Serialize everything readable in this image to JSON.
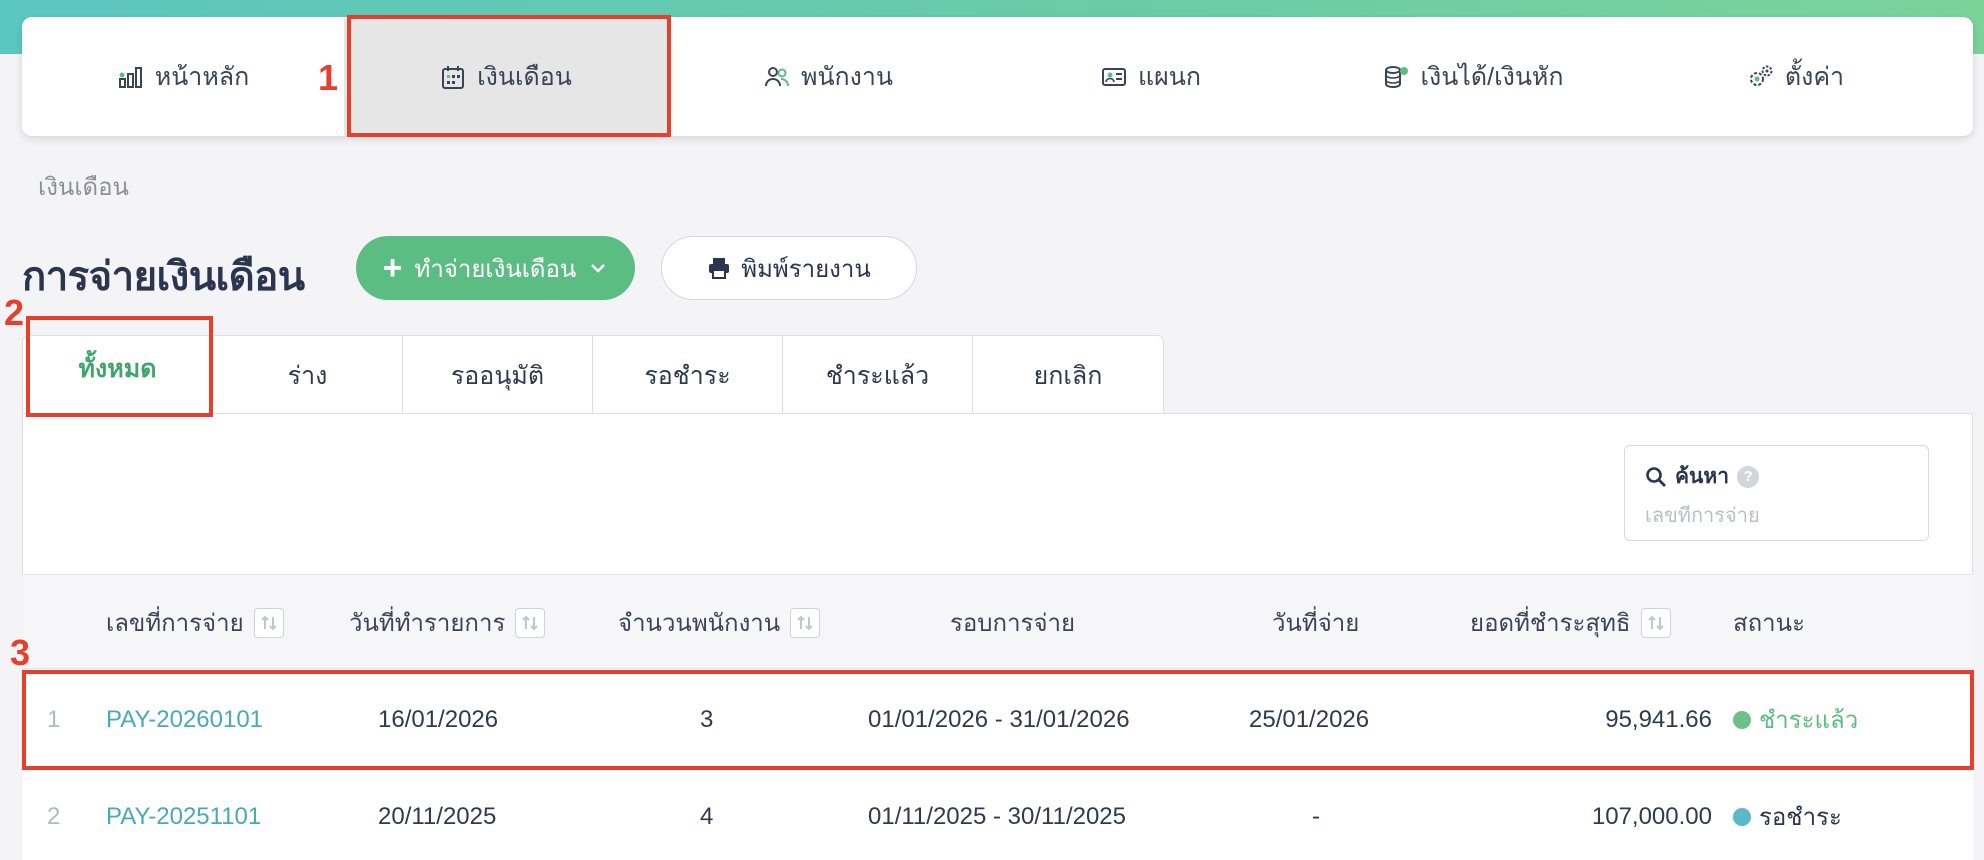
{
  "nav": {
    "items": [
      {
        "label": "หน้าหลัก",
        "icon": "bar-chart-icon"
      },
      {
        "label": "เงินเดือน",
        "icon": "calendar-icon"
      },
      {
        "label": "พนักงาน",
        "icon": "users-icon"
      },
      {
        "label": "แผนก",
        "icon": "id-card-icon"
      },
      {
        "label": "เงินได้/เงินหัก",
        "icon": "coins-icon"
      },
      {
        "label": "ตั้งค่า",
        "icon": "gears-icon"
      }
    ],
    "active_index": 1
  },
  "annotations": {
    "one": "1",
    "two": "2",
    "three": "3"
  },
  "breadcrumb": "เงินเดือน",
  "page_title": "การจ่ายเงินเดือน",
  "actions": {
    "create_label": "ทำจ่ายเงินเดือน",
    "print_label": "พิมพ์รายงาน"
  },
  "tabs": [
    {
      "label": "ทั้งหมด",
      "active": true
    },
    {
      "label": "ร่าง"
    },
    {
      "label": "รออนุมัติ"
    },
    {
      "label": "รอชำระ"
    },
    {
      "label": "ชำระแล้ว"
    },
    {
      "label": "ยกเลิก"
    }
  ],
  "search": {
    "label": "ค้นหา",
    "help": "?",
    "placeholder": "เลขที่การจ่าย"
  },
  "table": {
    "headers": {
      "pay_no": "เลขที่การจ่าย",
      "txn_date": "วันที่ทำรายการ",
      "employees": "จำนวนพนักงาน",
      "period": "รอบการจ่าย",
      "pay_date": "วันที่จ่าย",
      "net": "ยอดที่ชำระสุทธิ",
      "status": "สถานะ"
    },
    "rows": [
      {
        "idx": "1",
        "pay_no": "PAY-20260101",
        "txn_date": "16/01/2026",
        "employees": "3",
        "period": "01/01/2026 - 31/01/2026",
        "pay_date": "25/01/2026",
        "net": "95,941.66",
        "status": "ชำระแล้ว",
        "status_color": "#6cc08a"
      },
      {
        "idx": "2",
        "pay_no": "PAY-20251101",
        "txn_date": "20/11/2025",
        "employees": "4",
        "period": "01/11/2025 - 30/11/2025",
        "pay_date": "-",
        "net": "107,000.00",
        "status": "รอชำระ",
        "status_color": "#5bb8c6"
      }
    ]
  },
  "colors": {
    "accent": "#5cbd82",
    "link": "#48a9b8",
    "annotation": "#e5402b"
  }
}
